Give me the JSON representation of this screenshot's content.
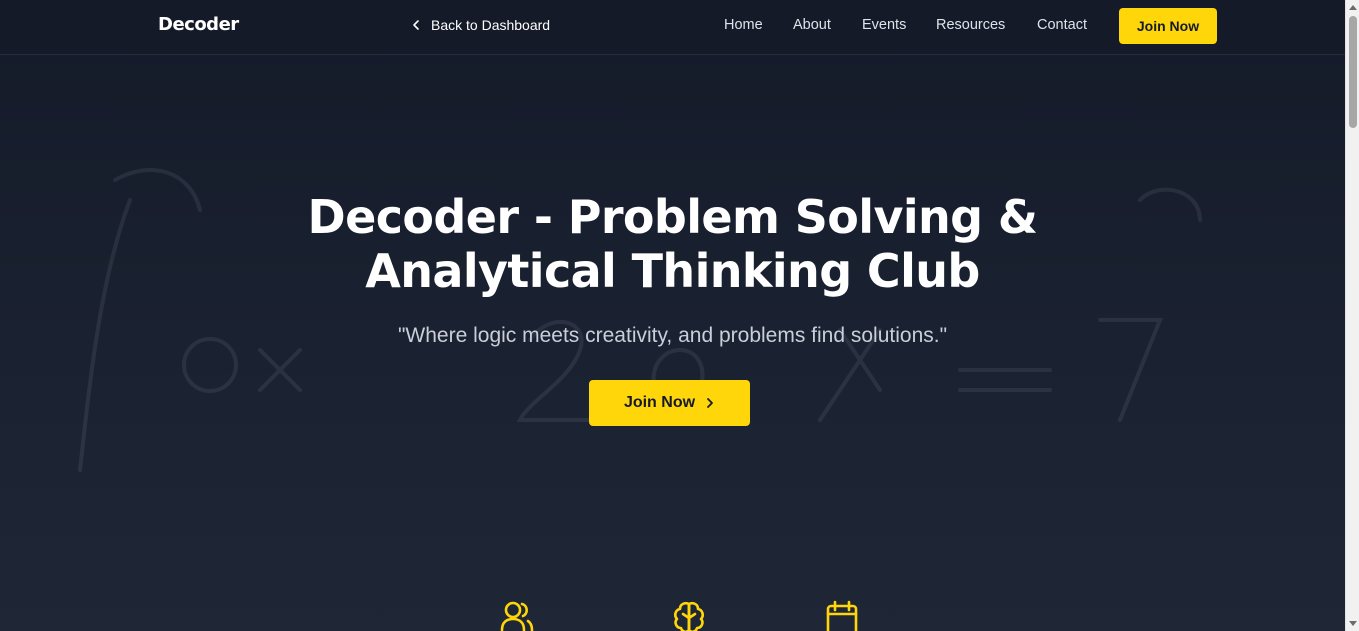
{
  "navbar": {
    "brand": "Decoder",
    "back_label": "Back to Dashboard",
    "links": [
      "Home",
      "About",
      "Events",
      "Resources",
      "Contact"
    ],
    "join_label": "Join Now"
  },
  "hero": {
    "title_line1": "Decoder - Problem Solving &",
    "title_line2": "Analytical Thinking Club",
    "subtitle": "\"Where logic meets creativity, and problems find solutions.\"",
    "join_label": "Join Now"
  },
  "features": {
    "icons": [
      "users-icon",
      "brain-icon",
      "calendar-icon"
    ]
  },
  "colors": {
    "accent": "#ffd60a",
    "background": "#19202f",
    "navbar": "#141a28",
    "text": "#ffffff",
    "muted_text": "#c9ced8"
  }
}
